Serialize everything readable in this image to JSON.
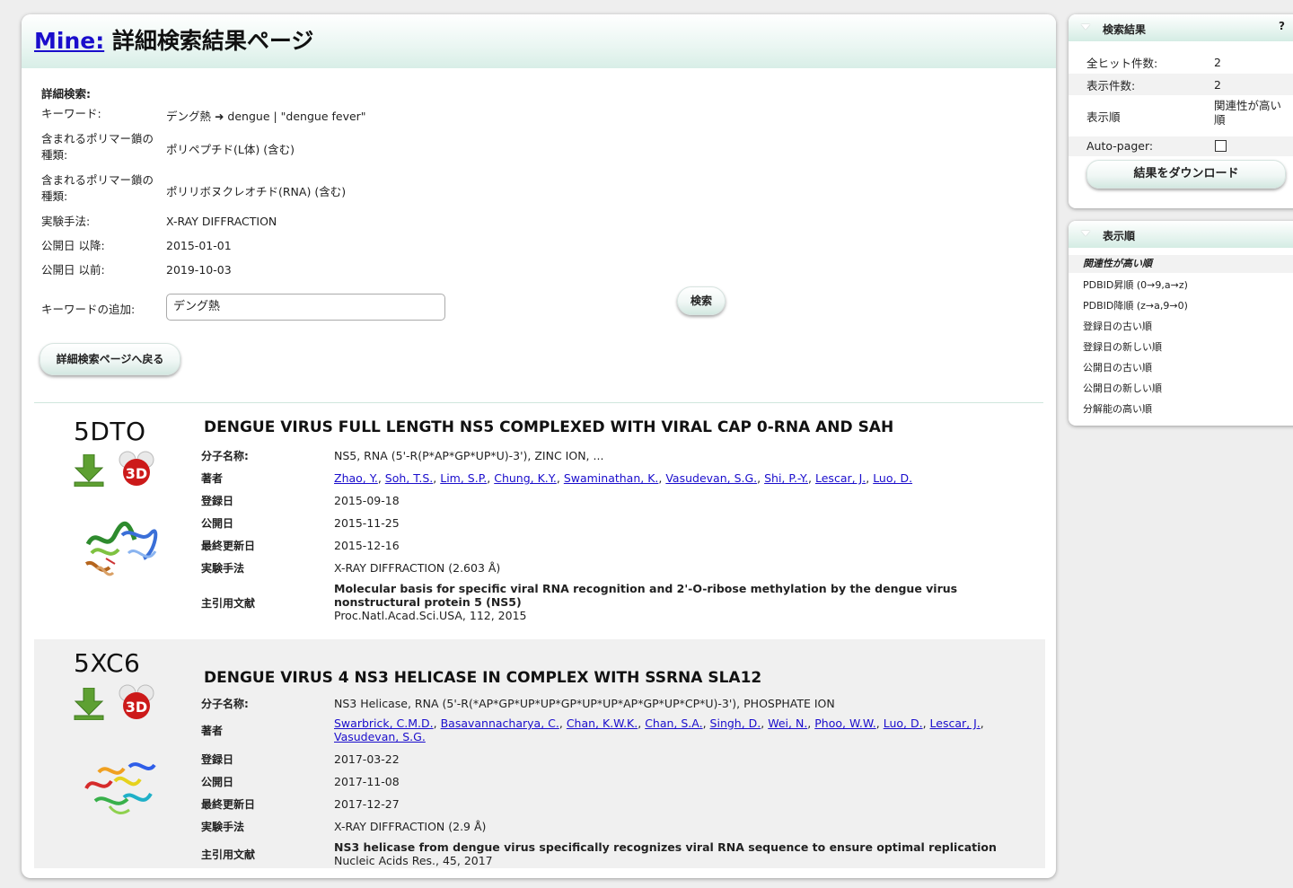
{
  "header": {
    "mine_link": "Mine:",
    "title": "詳細検索結果ページ"
  },
  "criteria": {
    "heading": "詳細検索:",
    "rows": [
      {
        "label": "キーワード:",
        "value": "デング熱 ➜ dengue | \"dengue fever\""
      },
      {
        "label": "含まれるポリマー鎖の種類:",
        "value": "ポリペプチド(L体) (含む)"
      },
      {
        "label": "含まれるポリマー鎖の種類:",
        "value": "ポリリボヌクレオチド(RNA) (含む)"
      },
      {
        "label": "実験手法:",
        "value": "X-RAY DIFFRACTION"
      },
      {
        "label": "公開日 以降:",
        "value": "2015-01-01"
      },
      {
        "label": "公開日 以前:",
        "value": "2019-10-03"
      }
    ],
    "add_keyword_label": "キーワードの追加:",
    "add_keyword_value": "デング熱",
    "search_button": "検索",
    "back_button": "詳細検索ページへ戻る"
  },
  "field_labels": {
    "molecule": "分子名称:",
    "authors": "著者",
    "deposited": "登録日",
    "released": "公開日",
    "revised": "最終更新日",
    "method": "実験手法",
    "citation": "主引用文献"
  },
  "results": [
    {
      "pdbid": "5DTO",
      "title": "DENGUE VIRUS FULL LENGTH NS5 COMPLEXED WITH VIRAL CAP 0-RNA AND SAH",
      "molecule": "NS5, RNA (5'-R(P*AP*GP*UP*U)-3'), ZINC ION, ...",
      "authors": [
        "Zhao, Y.",
        "Soh, T.S.",
        "Lim, S.P.",
        "Chung, K.Y.",
        "Swaminathan, K.",
        "Vasudevan, S.G.",
        "Shi, P.-Y.",
        "Lescar, J.",
        "Luo, D."
      ],
      "deposited": "2015-09-18",
      "released": "2015-11-25",
      "revised": "2015-12-16",
      "method": "X-RAY DIFFRACTION (2.603 Å)",
      "citation_title_1": "Molecular basis for specific viral RNA recognition and 2'-O-ribose methylation by the dengue virus",
      "citation_title_2": "nonstructural protein 5 (NS5)",
      "citation_journal": "Proc.Natl.Acad.Sci.USA, 112, 2015"
    },
    {
      "pdbid": "5XC6",
      "title": "DENGUE VIRUS 4 NS3 HELICASE IN COMPLEX WITH SSRNA SLA12",
      "molecule": "NS3 Helicase, RNA (5'-R(*AP*GP*UP*UP*GP*UP*UP*AP*GP*UP*CP*U)-3'), PHOSPHATE ION",
      "authors_line1": [
        "Swarbrick, C.M.D.",
        "Basavannacharya, C.",
        "Chan, K.W.K.",
        "Chan, S.A.",
        "Singh, D.",
        "Wei, N.",
        "Phoo, W.W.",
        "Luo, D.",
        "Lescar, J."
      ],
      "authors_line2": [
        "Vasudevan, S.G."
      ],
      "deposited": "2017-03-22",
      "released": "2017-11-08",
      "revised": "2017-12-27",
      "method": "X-RAY DIFFRACTION (2.9 Å)",
      "citation_title_1": "NS3 helicase from dengue virus specifically recognizes viral RNA sequence to ensure optimal replication",
      "citation_journal": "Nucleic Acids Res., 45, 2017"
    }
  ],
  "summary_panel": {
    "title": "検索結果",
    "help": "?",
    "total_hits_label": "全ヒット件数:",
    "total_hits": "2",
    "shown_label": "表示件数:",
    "shown": "2",
    "order_label": "表示順",
    "order_value": "関連性が高い順",
    "autopager_label": "Auto-pager:",
    "autopager_checked": false,
    "download_button": "結果をダウンロード"
  },
  "sort_panel": {
    "title": "表示順",
    "options": [
      "関連性が高い順",
      "PDBID昇順 (0→9,a→z)",
      "PDBID降順 (z→a,9→0)",
      "登録日の古い順",
      "登録日の新しい順",
      "公開日の古い順",
      "公開日の新しい順",
      "分解能の高い順"
    ],
    "active_index": 0
  },
  "colors": {
    "link": "#1a0dcc",
    "download_green": "#5ea032",
    "molecule_red": "#cc1a1a",
    "header_tint": "#d8eee7"
  },
  "icons": [
    "download-arrow-icon",
    "3d-view-icon",
    "structure-thumbnail"
  ]
}
